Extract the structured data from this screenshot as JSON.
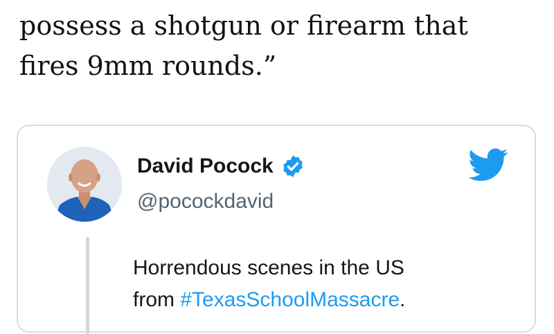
{
  "article": {
    "lines": [
      "possess a shotgun or firearm that",
      "fires 9mm rounds.”"
    ]
  },
  "tweet": {
    "author_name": "David Pocock",
    "handle": "@pocockdavid",
    "verified": true,
    "text_line1": "Horrendous scenes in the US",
    "text_line2_prefix": "from ",
    "hashtag": "#TexasSchoolMassacre",
    "text_line2_suffix": "."
  },
  "icons": {
    "verified": "verified-badge-icon",
    "brand": "twitter-bird-icon"
  },
  "colors": {
    "brand_blue": "#1d9bf0",
    "text": "#14171a",
    "muted": "#536471",
    "card_border": "#d6dde3"
  }
}
